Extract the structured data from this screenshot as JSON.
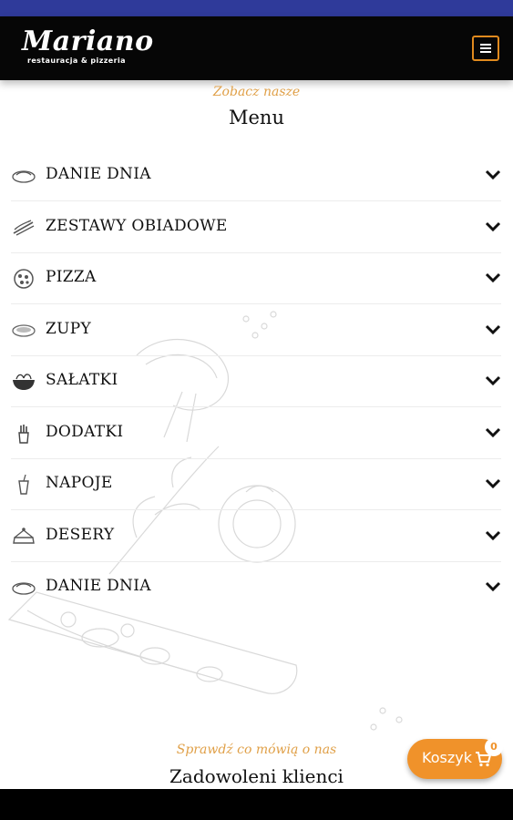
{
  "header": {
    "logo_name": "Mariano",
    "logo_sub": "restauracja & pizzeria"
  },
  "section": {
    "subtitle": "Zobacz nasze",
    "title": "Menu"
  },
  "menu": {
    "items": [
      {
        "label": "DANIE DNIA",
        "icon": "dish-icon"
      },
      {
        "label": "ZESTAWY OBIADOWE",
        "icon": "set-meal-icon"
      },
      {
        "label": "PIZZA",
        "icon": "pizza-icon"
      },
      {
        "label": "ZUPY",
        "icon": "soup-icon"
      },
      {
        "label": "SAŁATKI",
        "icon": "salad-icon"
      },
      {
        "label": "DODATKI",
        "icon": "fries-icon"
      },
      {
        "label": "NAPOJE",
        "icon": "drink-icon"
      },
      {
        "label": "DESERY",
        "icon": "cake-icon"
      },
      {
        "label": "DANIE DNIA",
        "icon": "dish-icon"
      }
    ]
  },
  "reviews": {
    "subtitle": "Sprawdź co mówią o nas",
    "title": "Zadowoleni klienci"
  },
  "cart": {
    "label": "Koszyk",
    "count": "0"
  },
  "colors": {
    "accent": "#f0922a",
    "header_bg": "#060606",
    "statusbar": "#2f3a9a"
  }
}
